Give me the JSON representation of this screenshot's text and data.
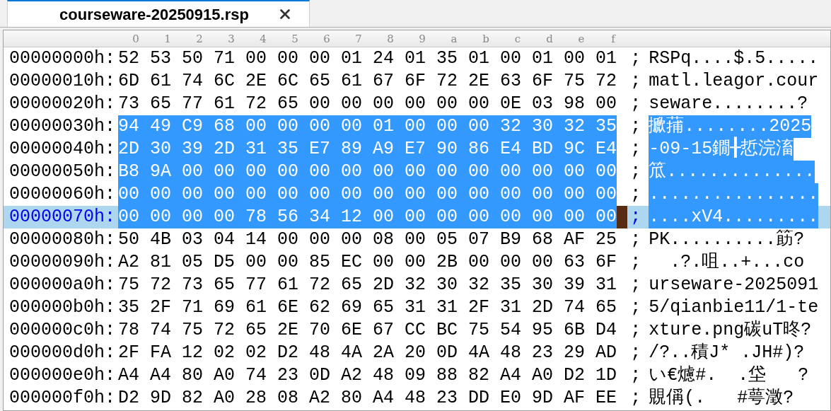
{
  "tabs": [
    {
      "title": "courseware-20250915.rsp",
      "selected": true
    }
  ],
  "columns": [
    "0",
    "1",
    "2",
    "3",
    "4",
    "5",
    "6",
    "7",
    "8",
    "9",
    "a",
    "b",
    "c",
    "d",
    "e",
    "f"
  ],
  "rows": [
    {
      "offset": "00000000h:",
      "bytes": [
        "52",
        "53",
        "50",
        "71",
        "00",
        "00",
        "00",
        "01",
        "24",
        "01",
        "35",
        "01",
        "00",
        "01",
        "00",
        "01"
      ],
      "separator": ";",
      "ascii": "RSPq....$.5.....",
      "selected": false,
      "current": false
    },
    {
      "offset": "00000010h:",
      "bytes": [
        "6D",
        "61",
        "74",
        "6C",
        "2E",
        "6C",
        "65",
        "61",
        "67",
        "6F",
        "72",
        "2E",
        "63",
        "6F",
        "75",
        "72"
      ],
      "separator": ";",
      "ascii": "matl.leagor.cour",
      "selected": false,
      "current": false
    },
    {
      "offset": "00000020h:",
      "bytes": [
        "73",
        "65",
        "77",
        "61",
        "72",
        "65",
        "00",
        "00",
        "00",
        "00",
        "00",
        "00",
        "0E",
        "03",
        "98",
        "00"
      ],
      "separator": ";",
      "ascii": "seware........?",
      "selected": false,
      "current": false
    },
    {
      "offset": "00000030h:",
      "bytes": [
        "94",
        "49",
        "C9",
        "68",
        "00",
        "00",
        "00",
        "00",
        "01",
        "00",
        "00",
        "00",
        "32",
        "30",
        "32",
        "35"
      ],
      "separator": ";",
      "ascii": "擨蒱........2025",
      "selected": true,
      "current": false
    },
    {
      "offset": "00000040h:",
      "bytes": [
        "2D",
        "30",
        "39",
        "2D",
        "31",
        "35",
        "E7",
        "89",
        "A9",
        "E7",
        "90",
        "86",
        "E4",
        "BD",
        "9C",
        "E4"
      ],
      "separator": ";",
      "ascii": "-09-15鐗╂悊浣滀",
      "selected": true,
      "current": false
    },
    {
      "offset": "00000050h:",
      "bytes": [
        "B8",
        "9A",
        "00",
        "00",
        "00",
        "00",
        "00",
        "00",
        "00",
        "00",
        "00",
        "00",
        "00",
        "00",
        "00",
        "00"
      ],
      "separator": ";",
      "ascii": "笟..............",
      "selected": true,
      "current": false
    },
    {
      "offset": "00000060h:",
      "bytes": [
        "00",
        "00",
        "00",
        "00",
        "00",
        "00",
        "00",
        "00",
        "00",
        "00",
        "00",
        "00",
        "00",
        "00",
        "00",
        "00"
      ],
      "separator": ";",
      "ascii": "................",
      "selected": true,
      "current": false
    },
    {
      "offset": "00000070h:",
      "bytes": [
        "00",
        "00",
        "00",
        "00",
        "78",
        "56",
        "34",
        "12",
        "00",
        "00",
        "00",
        "00",
        "00",
        "00",
        "00",
        "00"
      ],
      "separator": ";",
      "ascii": "....xV4.........",
      "selected": true,
      "current": true
    },
    {
      "offset": "00000080h:",
      "bytes": [
        "50",
        "4B",
        "03",
        "04",
        "14",
        "00",
        "00",
        "00",
        "08",
        "00",
        "05",
        "07",
        "B9",
        "68",
        "AF",
        "25"
      ],
      "separator": ";",
      "ascii": "PK..........筯?",
      "selected": false,
      "current": false
    },
    {
      "offset": "00000090h:",
      "bytes": [
        "A2",
        "81",
        "05",
        "D5",
        "00",
        "00",
        "85",
        "EC",
        "00",
        "00",
        "2B",
        "00",
        "00",
        "00",
        "63",
        "6F"
      ],
      "separator": ";",
      "ascii": "  .?.咀..+...co",
      "selected": false,
      "current": false
    },
    {
      "offset": "000000a0h:",
      "bytes": [
        "75",
        "72",
        "73",
        "65",
        "77",
        "61",
        "72",
        "65",
        "2D",
        "32",
        "30",
        "32",
        "35",
        "30",
        "39",
        "31"
      ],
      "separator": ";",
      "ascii": "urseware-2025091",
      "selected": false,
      "current": false
    },
    {
      "offset": "000000b0h:",
      "bytes": [
        "35",
        "2F",
        "71",
        "69",
        "61",
        "6E",
        "62",
        "69",
        "65",
        "31",
        "31",
        "2F",
        "31",
        "2D",
        "74",
        "65"
      ],
      "separator": ";",
      "ascii": "5/qianbie11/1-te",
      "selected": false,
      "current": false
    },
    {
      "offset": "000000c0h:",
      "bytes": [
        "78",
        "74",
        "75",
        "72",
        "65",
        "2E",
        "70",
        "6E",
        "67",
        "CC",
        "BC",
        "75",
        "54",
        "95",
        "6B",
        "D4"
      ],
      "separator": ";",
      "ascii": "xture.png碳uT昸?",
      "selected": false,
      "current": false
    },
    {
      "offset": "000000d0h:",
      "bytes": [
        "2F",
        "FA",
        "12",
        "02",
        "02",
        "D2",
        "48",
        "4A",
        "2A",
        "20",
        "0D",
        "4A",
        "48",
        "23",
        "29",
        "AD"
      ],
      "separator": ";",
      "ascii": "/?..積J* .JH#)?",
      "selected": false,
      "current": false
    },
    {
      "offset": "000000e0h:",
      "bytes": [
        "A4",
        "A4",
        "80",
        "A0",
        "74",
        "23",
        "0D",
        "A2",
        "48",
        "09",
        "88",
        "82",
        "A4",
        "A0",
        "D2",
        "1D"
      ],
      "separator": ";",
      "ascii": "い€爈#.  .垈   ?",
      "selected": false,
      "current": false
    },
    {
      "offset": "000000f0h:",
      "bytes": [
        "D2",
        "9D",
        "82",
        "A0",
        "28",
        "08",
        "A2",
        "80",
        "A4",
        "48",
        "23",
        "DD",
        "E0",
        "9D",
        "AF",
        "EE"
      ],
      "separator": ";",
      "ascii": "覞偁(.   #萼澂?",
      "selected": false,
      "current": false
    }
  ]
}
